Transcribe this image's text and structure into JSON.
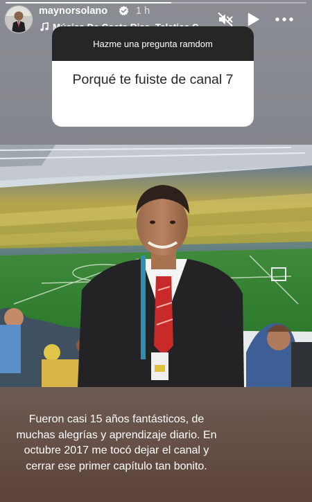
{
  "story": {
    "progress": 0.55,
    "username": "maynorsolano",
    "time": "1 h",
    "music_label": "Música De Costa Rica, Teletica C",
    "icons": {
      "avatar": "profile-avatar",
      "verified": "verified-badge-icon",
      "music": "music-note-icon",
      "mute": "muted-speaker-icon",
      "play": "play-icon",
      "more": "more-options-icon"
    }
  },
  "question_sticker": {
    "prompt": "Hazme una pregunta ramdom",
    "answer": "Porqué te fuiste de canal 7"
  },
  "caption": {
    "text": "Fueron casi 15 años fantásticos, de muchas alegrías y aprendizaje diario.  En octubre 2017 me tocó dejar el canal y  cerrar ese primer capítulo tan bonito."
  },
  "colors": {
    "sticker_header": "#262626",
    "verified": "#ffffff"
  }
}
